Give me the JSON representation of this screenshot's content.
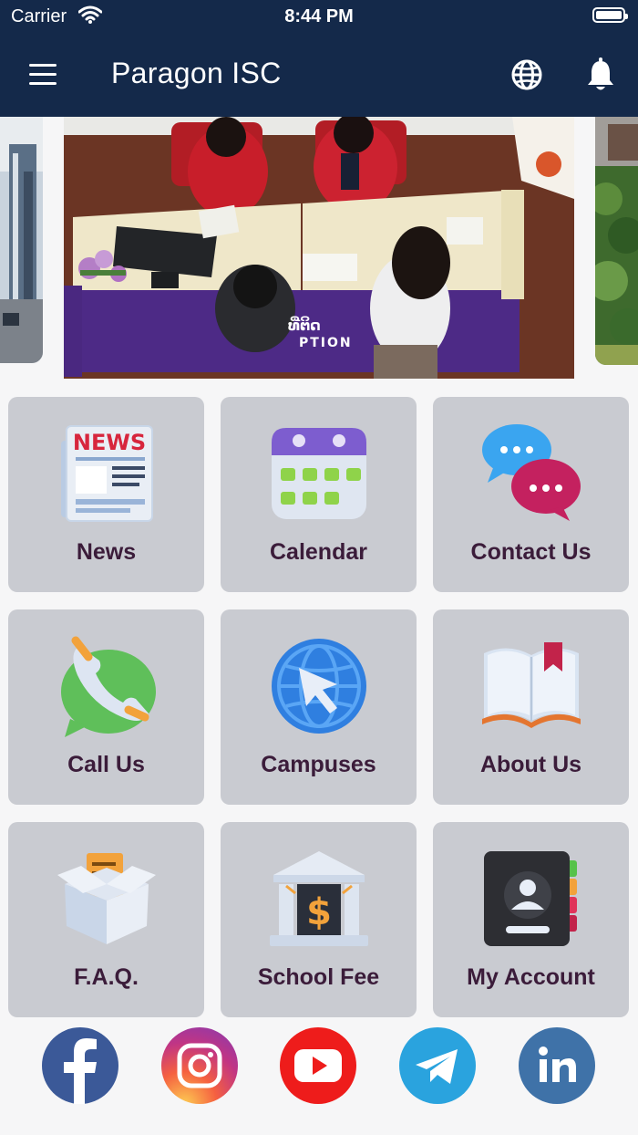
{
  "status_bar": {
    "carrier": "Carrier",
    "time": "8:44 PM"
  },
  "header": {
    "title": "Paragon ISC"
  },
  "carousel": {
    "sign_text_1": "ທີ່ຕິດ",
    "sign_text_2": "PTION"
  },
  "tiles": [
    {
      "label": "News",
      "icon": "newspaper-icon",
      "icon_text": "NEWS"
    },
    {
      "label": "Calendar",
      "icon": "calendar-icon"
    },
    {
      "label": "Contact Us",
      "icon": "chat-bubbles-icon"
    },
    {
      "label": "Call Us",
      "icon": "phone-icon"
    },
    {
      "label": "Campuses",
      "icon": "globe-cursor-icon"
    },
    {
      "label": "About Us",
      "icon": "open-book-icon"
    },
    {
      "label": "F.A.Q.",
      "icon": "box-icon"
    },
    {
      "label": "School Fee",
      "icon": "bank-dollar-icon"
    },
    {
      "label": "My Account",
      "icon": "address-book-icon"
    }
  ],
  "social": [
    {
      "name": "facebook",
      "color": "#3b5998"
    },
    {
      "name": "instagram",
      "color": "#e1306c"
    },
    {
      "name": "youtube",
      "color": "#ee1c1b"
    },
    {
      "name": "telegram",
      "color": "#2aa3de"
    },
    {
      "name": "linkedin",
      "color": "#3f72a8"
    }
  ],
  "colors": {
    "header_bg": "#14294a",
    "tile_bg": "#c9cbd1",
    "tile_label": "#3b1c3a"
  }
}
